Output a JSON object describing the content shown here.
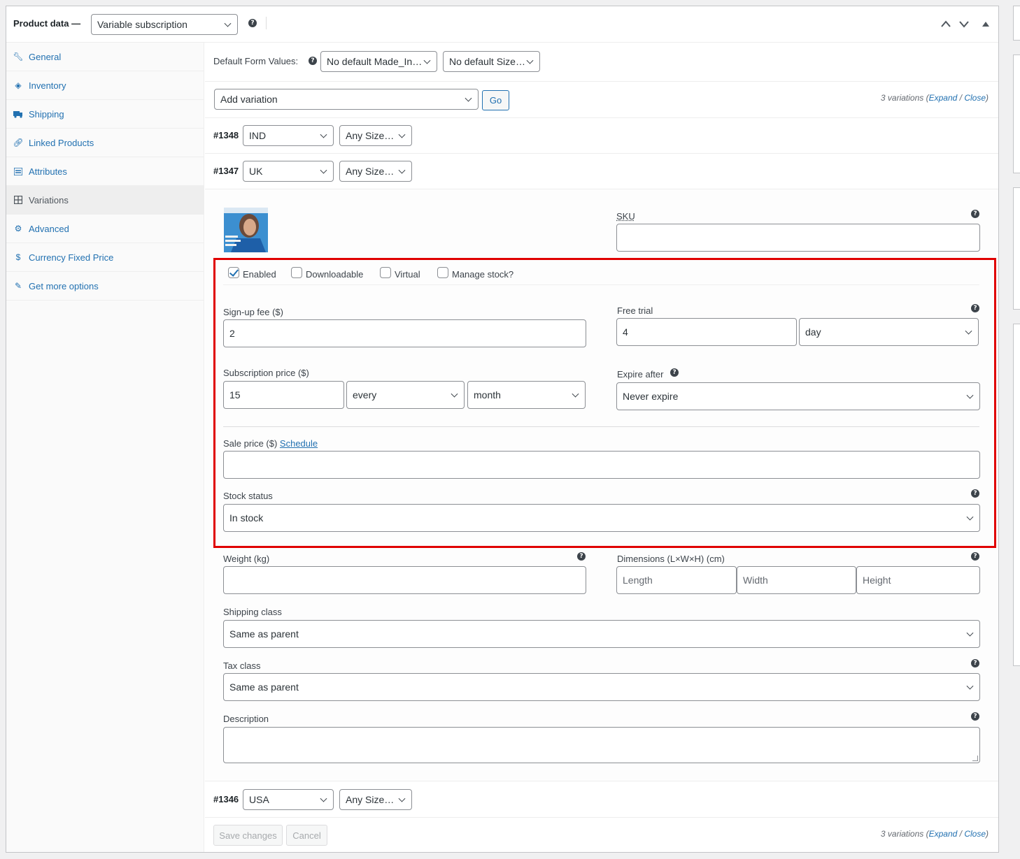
{
  "header": {
    "title": "Product data —",
    "product_type": "Variable subscription"
  },
  "tabs": [
    {
      "label": "General",
      "icon": "wrench-icon"
    },
    {
      "label": "Inventory",
      "icon": "tag-icon"
    },
    {
      "label": "Shipping",
      "icon": "truck-icon"
    },
    {
      "label": "Linked Products",
      "icon": "link-icon"
    },
    {
      "label": "Attributes",
      "icon": "list-icon"
    },
    {
      "label": "Variations",
      "icon": "grid-icon"
    },
    {
      "label": "Advanced",
      "icon": "gear-icon"
    },
    {
      "label": "Currency Fixed Price",
      "icon": "coin-icon"
    },
    {
      "label": "Get more options",
      "icon": "plugin-icon"
    }
  ],
  "defaults": {
    "label": "Default Form Values:",
    "made_in": "No default Made_In…",
    "size": "No default Size…"
  },
  "actions": {
    "add_variation": "Add variation",
    "go": "Go",
    "count_text": "3 variations (",
    "expand": "Expand",
    "sep": " / ",
    "close": "Close",
    "close_paren": ")"
  },
  "variations": [
    {
      "id": "#1348",
      "made_in": "IND",
      "size": "Any Size…"
    },
    {
      "id": "#1347",
      "made_in": "UK",
      "size": "Any Size…"
    },
    {
      "id": "#1346",
      "made_in": "USA",
      "size": "Any Size…"
    }
  ],
  "form": {
    "sku_label": "SKU",
    "enabled": "Enabled",
    "downloadable": "Downloadable",
    "virtual": "Virtual",
    "manage_stock": "Manage stock?",
    "signup_fee_label": "Sign-up fee ($)",
    "signup_fee": "2",
    "free_trial_label": "Free trial",
    "free_trial": "4",
    "free_trial_period": "day",
    "sub_price_label": "Subscription price ($)",
    "sub_price": "15",
    "sub_interval": "every",
    "sub_period": "month",
    "expire_label": "Expire after",
    "expire_value": "Never expire",
    "sale_label": "Sale price ($) ",
    "schedule": "Schedule",
    "stock_label": "Stock status",
    "stock_value": "In stock",
    "weight_label": "Weight (kg)",
    "dims_label": "Dimensions (L×W×H) (cm)",
    "length_ph": "Length",
    "width_ph": "Width",
    "height_ph": "Height",
    "shipping_label": "Shipping class",
    "shipping_value": "Same as parent",
    "tax_label": "Tax class",
    "tax_value": "Same as parent",
    "desc_label": "Description"
  },
  "footer": {
    "save": "Save changes",
    "cancel": "Cancel"
  },
  "colors": {
    "highlight": "#e00000",
    "link": "#2271b1"
  }
}
